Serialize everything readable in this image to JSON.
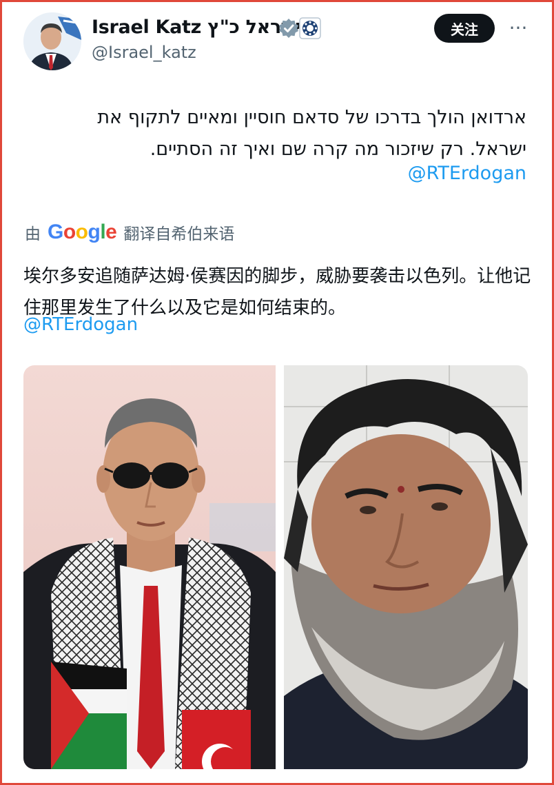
{
  "author": {
    "display_name": "Israel Katz ישראל כ\"ץ",
    "handle": "@Israel_katz",
    "verified_icon": "verified-check-icon",
    "affiliation_icon": "israel-government-badge-icon"
  },
  "actions": {
    "follow_label": "关注",
    "more_icon": "more-horizontal-icon",
    "more_glyph": "···"
  },
  "tweet": {
    "text_he": "ארדואן הולך בדרכו של סדאם חוסיין ומאיים לתקוף את ישראל. רק שיזכור מה קרה שם ואיך זה הסתיים.",
    "mention_he": "@RTErdogan"
  },
  "translation": {
    "by_label": "由",
    "provider": "Google",
    "from_label": "翻译自希伯来语",
    "text_zh": "埃尔多安追随萨达姆·侯赛因的脚步，威胁要袭击以色列。让他记住那里发生了什么以及它是如何结束的。",
    "mention_zh": "@RTErdogan"
  },
  "colors": {
    "frame": "#e0483a",
    "mention": "#1d9bf0",
    "secondary_text": "#536471",
    "button_bg": "#0f1419",
    "verified": "#829aab"
  }
}
